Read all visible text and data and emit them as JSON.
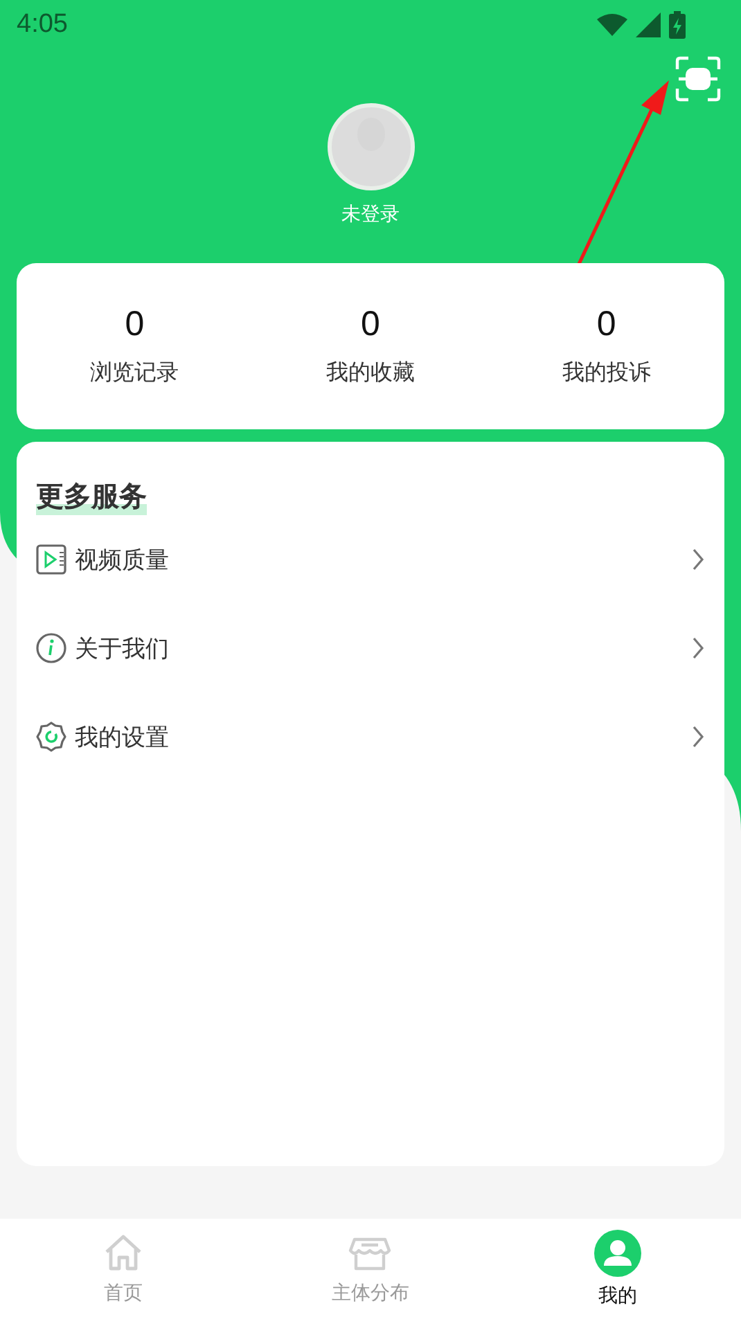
{
  "status_bar": {
    "time": "4:05"
  },
  "profile": {
    "name": "未登录"
  },
  "stats": [
    {
      "value": "0",
      "label": "浏览记录"
    },
    {
      "value": "0",
      "label": "我的收藏"
    },
    {
      "value": "0",
      "label": "我的投诉"
    }
  ],
  "services": {
    "title": "更多服务",
    "items": [
      {
        "kind": "video",
        "label": "视频质量"
      },
      {
        "kind": "info",
        "label": "关于我们"
      },
      {
        "kind": "settings",
        "label": "我的设置"
      }
    ]
  },
  "tabs": [
    {
      "kind": "home",
      "label": "首页",
      "selected": false
    },
    {
      "kind": "store",
      "label": "主体分布",
      "selected": false
    },
    {
      "kind": "user",
      "label": "我的",
      "selected": true
    }
  ]
}
